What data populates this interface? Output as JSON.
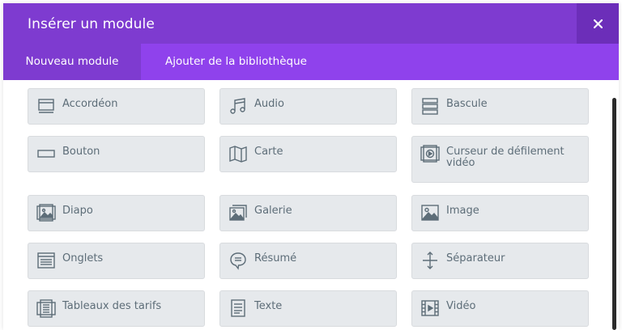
{
  "dialog": {
    "title": "Insérer un module",
    "close_label": "×"
  },
  "tabs": [
    {
      "label": "Nouveau module",
      "active": true
    },
    {
      "label": "Ajouter de la bibliothèque",
      "active": false
    }
  ],
  "colors": {
    "header": "#7e3bd0",
    "tabs_bar": "#8f42ec",
    "module_bg": "#e6e9ec",
    "module_text": "#5d6d78"
  },
  "modules": [
    {
      "label": "Accordéon",
      "icon": "accordion-icon"
    },
    {
      "label": "Audio",
      "icon": "music-note-icon"
    },
    {
      "label": "Bascule",
      "icon": "toggle-icon"
    },
    {
      "label": "Bouton",
      "icon": "button-icon"
    },
    {
      "label": "Carte",
      "icon": "map-icon"
    },
    {
      "label": "Curseur de défilement vidéo",
      "icon": "video-slider-icon"
    },
    {
      "label": "Diapo",
      "icon": "slider-icon"
    },
    {
      "label": "Galerie",
      "icon": "gallery-icon"
    },
    {
      "label": "Image",
      "icon": "image-icon"
    },
    {
      "label": "Onglets",
      "icon": "tabs-icon"
    },
    {
      "label": "Résumé",
      "icon": "speech-bubble-icon"
    },
    {
      "label": "Séparateur",
      "icon": "divider-icon"
    },
    {
      "label": "Tableaux des tarifs",
      "icon": "pricing-table-icon"
    },
    {
      "label": "Texte",
      "icon": "text-icon"
    },
    {
      "label": "Vidéo",
      "icon": "film-icon"
    }
  ]
}
